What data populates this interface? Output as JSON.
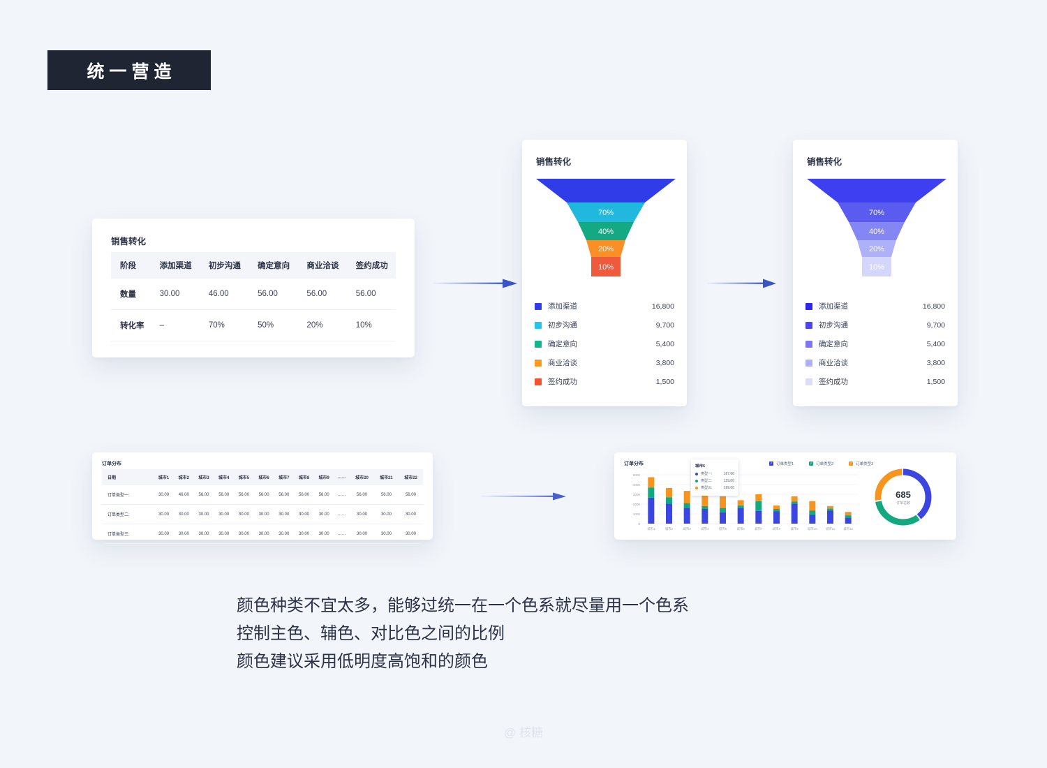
{
  "header": {
    "badge_title": "统一营造"
  },
  "conversion_table": {
    "card_title": "销售转化",
    "columns": [
      "阶段",
      "添加渠道",
      "初步沟通",
      "确定意向",
      "商业洽谈",
      "签约成功"
    ],
    "rows": [
      {
        "label": "数量",
        "values": [
          "30.00",
          "46.00",
          "56.00",
          "56.00",
          "56.00"
        ]
      },
      {
        "label": "转化率",
        "values": [
          "–",
          "70%",
          "50%",
          "20%",
          "10%"
        ]
      }
    ]
  },
  "funnel_multicolor": {
    "card_title": "销售转化",
    "band_labels": [
      "",
      "70%",
      "40%",
      "20%",
      "10%"
    ],
    "colors": [
      "#2f3ce8",
      "#21b8dd",
      "#14a983",
      "#fa9025",
      "#f05a3c"
    ],
    "legend": [
      {
        "name": "添加渠道",
        "value": "16,800",
        "color": "#2f3ce8"
      },
      {
        "name": "初步沟通",
        "value": "9,700",
        "color": "#21c5ef"
      },
      {
        "name": "确定意向",
        "value": "5,400",
        "color": "#0db88d"
      },
      {
        "name": "商业洽谈",
        "value": "3,800",
        "color": "#fb9a1c"
      },
      {
        "name": "签约成功",
        "value": "1,500",
        "color": "#f5512c"
      }
    ]
  },
  "funnel_mono": {
    "card_title": "销售转化",
    "band_labels": [
      "",
      "70%",
      "40%",
      "20%",
      "10%"
    ],
    "colors": [
      "#3d3ff0",
      "#5a5cf0",
      "#8486f4",
      "#aeb0f8",
      "#d5d6fb"
    ],
    "legend": [
      {
        "name": "添加渠道",
        "value": "16,800",
        "color": "#2f25ee"
      },
      {
        "name": "初步沟通",
        "value": "9,700",
        "color": "#4a45f1"
      },
      {
        "name": "确定意向",
        "value": "5,400",
        "color": "#7a78f5"
      },
      {
        "name": "商业洽谈",
        "value": "3,800",
        "color": "#b0aff9"
      },
      {
        "name": "签约成功",
        "value": "1,500",
        "color": "#dcdcfc"
      }
    ]
  },
  "order_table": {
    "card_title": "订单分布",
    "columns": [
      "日期",
      "城市1",
      "城市2",
      "城市3",
      "城市4",
      "城市5",
      "城市6",
      "城市7",
      "城市8",
      "城市9",
      "……",
      "城市20",
      "城市21",
      "城市22"
    ],
    "rows": [
      {
        "label": "订单类型一:",
        "values": [
          "30.00",
          "46.00",
          "56.00",
          "56.00",
          "56.00",
          "56.00",
          "56.00",
          "56.00",
          "56.00",
          "……",
          "56.00",
          "56.00",
          "56.00"
        ]
      },
      {
        "label": "订单类型二:",
        "values": [
          "30.00",
          "30.00",
          "30.00",
          "30.00",
          "30.00",
          "30.00",
          "30.00",
          "30.00",
          "30.00",
          "……",
          "30.00",
          "30.00",
          "30.00"
        ]
      },
      {
        "label": "订单类型三:",
        "values": [
          "30.00",
          "30.00",
          "30.00",
          "30.00",
          "30.00",
          "30.00",
          "30.00",
          "30.00",
          "30.00",
          "……",
          "30.00",
          "30.00",
          "30.00"
        ]
      }
    ]
  },
  "bar_chart_card": {
    "card_title": "订单分布",
    "legend": [
      {
        "label": "订单类型1",
        "color": "#3b46e0"
      },
      {
        "label": "订单类型2",
        "color": "#13a87f"
      },
      {
        "label": "订单类型3",
        "color": "#f7941f"
      }
    ],
    "tooltip": {
      "title": "城市6",
      "rows": [
        {
          "name": "类型一:",
          "value": "167.60",
          "color": "#3b46e0"
        },
        {
          "name": "类型二:",
          "value": "129.00",
          "color": "#13a87f"
        },
        {
          "name": "类型三:",
          "value": "199.00",
          "color": "#f7941f"
        }
      ]
    },
    "donut": {
      "center_value": "685",
      "center_label": "订单总数",
      "segments": [
        {
          "color": "#3b46e0",
          "percent": 40
        },
        {
          "color": "#13a87f",
          "percent": 33
        },
        {
          "color": "#f7941f",
          "percent": 27
        }
      ]
    }
  },
  "chart_data": {
    "type": "bar",
    "title": "订单分布",
    "xlabel": "",
    "ylabel": "",
    "ylim": [
      0,
      5000
    ],
    "yticks": [
      0,
      1000,
      2000,
      3000,
      4000,
      5000
    ],
    "grid": true,
    "stacked": true,
    "legend_position": "top-right",
    "categories": [
      "城市1",
      "城市2",
      "城市3",
      "城市4",
      "城市5",
      "城市6",
      "城市7",
      "城市8",
      "城市9",
      "城市10",
      "城市11",
      "城市12"
    ],
    "series": [
      {
        "name": "订单类型1",
        "color": "#3b46e0",
        "values": [
          2650,
          2050,
          1600,
          1500,
          1150,
          1600,
          1300,
          1250,
          2050,
          900,
          1350,
          600
        ]
      },
      {
        "name": "订单类型2",
        "color": "#13a87f",
        "values": [
          1050,
          650,
          500,
          300,
          450,
          250,
          1000,
          250,
          200,
          450,
          200,
          250
        ]
      },
      {
        "name": "订单类型3",
        "color": "#f7941f",
        "values": [
          1050,
          950,
          1250,
          1250,
          1200,
          550,
          700,
          350,
          550,
          950,
          250,
          350
        ]
      }
    ]
  },
  "caption": {
    "lines": [
      "颜色种类不宜太多，能够过统一在一个色系就尽量用一个色系",
      "控制主色、辅色、对比色之间的比例",
      "颜色建议采用低明度高饱和的颜色"
    ]
  },
  "watermark": {
    "text": "@ 核糖"
  }
}
